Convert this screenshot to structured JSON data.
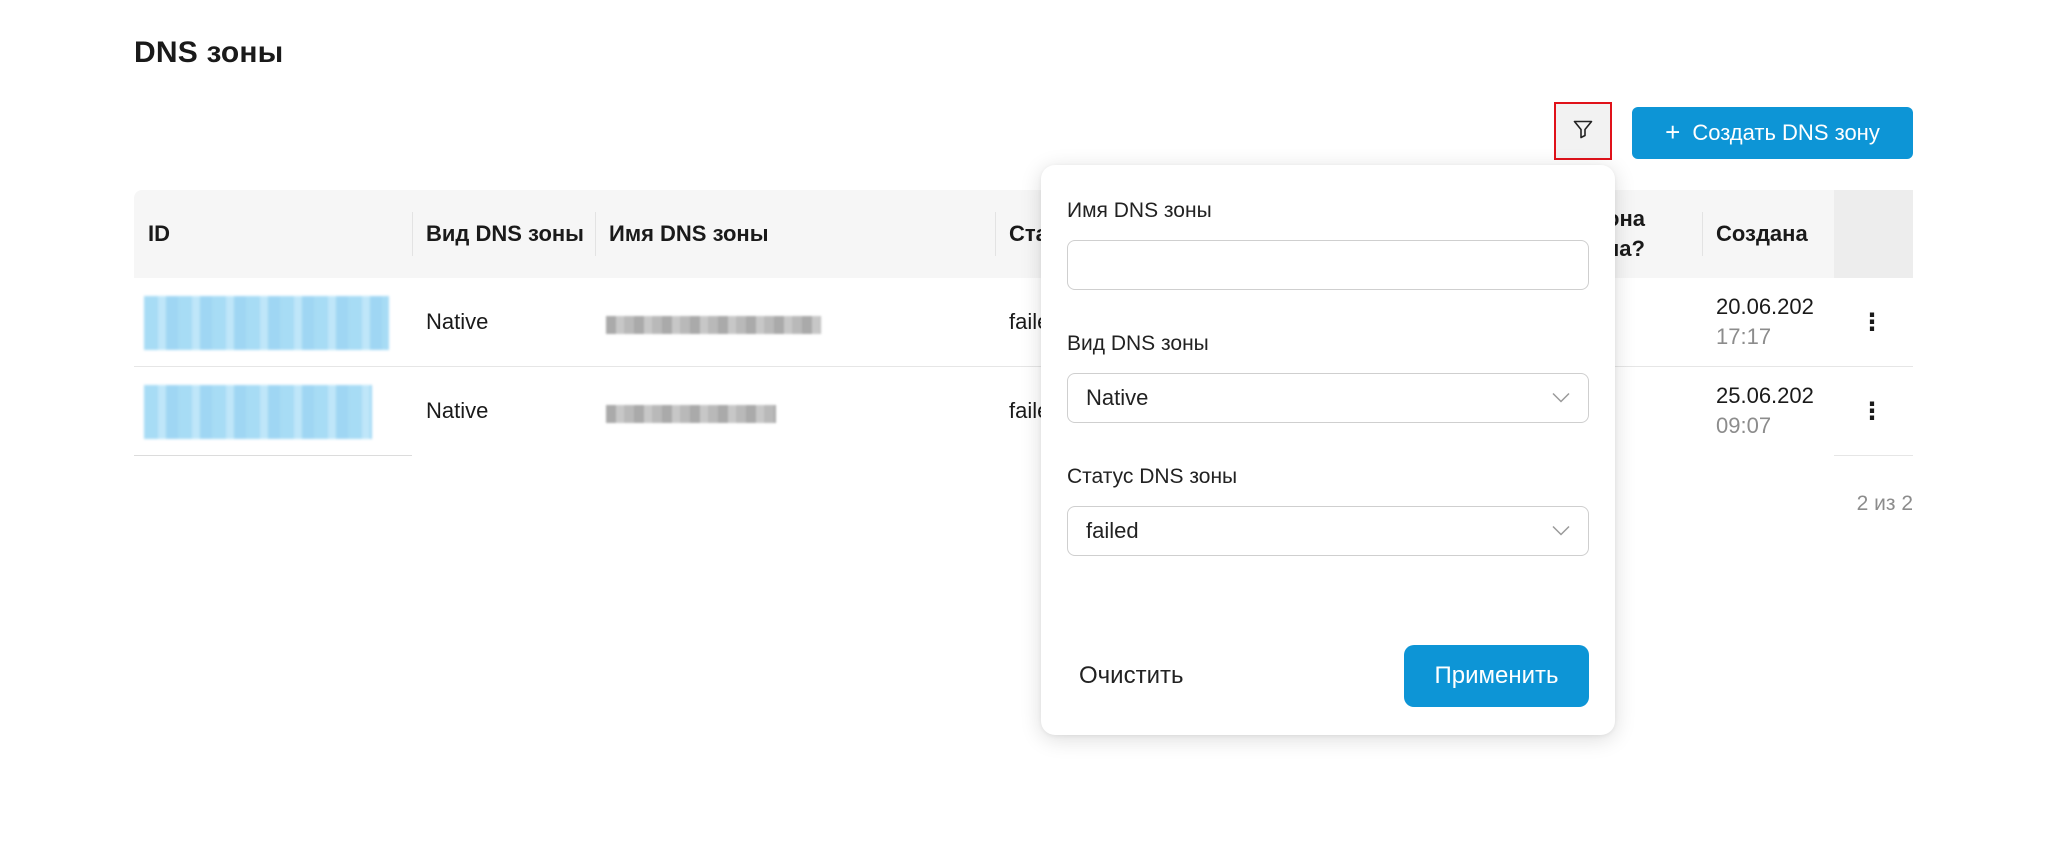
{
  "page": {
    "title": "DNS зоны"
  },
  "toolbar": {
    "filter_icon": "filter-icon",
    "create_label": "Создать DNS зону",
    "create_icon": "+"
  },
  "table": {
    "columns": {
      "id": "ID",
      "zone_type": "Вид DNS зоны",
      "zone_name": "Имя DNS зоны",
      "status": "Ста",
      "delegated": "она\nна?",
      "created": "Создана"
    },
    "rows": [
      {
        "zone_type": "Native",
        "status": "faile",
        "created_date": "20.06.202",
        "created_time": "17:17"
      },
      {
        "zone_type": "Native",
        "status": "faile",
        "created_date": "25.06.202",
        "created_time": "09:07"
      }
    ],
    "row_menu_icon": "⋮"
  },
  "pagination": {
    "text": "2 из 2"
  },
  "filter_popover": {
    "name_label": "Имя DNS зоны",
    "name_value": "",
    "type_label": "Вид DNS зоны",
    "type_value": "Native",
    "status_label": "Статус DNS зоны",
    "status_value": "failed",
    "clear_label": "Очистить",
    "apply_label": "Применить"
  },
  "colors": {
    "accent": "#0d95d6",
    "focus_outline": "#e0121a"
  }
}
